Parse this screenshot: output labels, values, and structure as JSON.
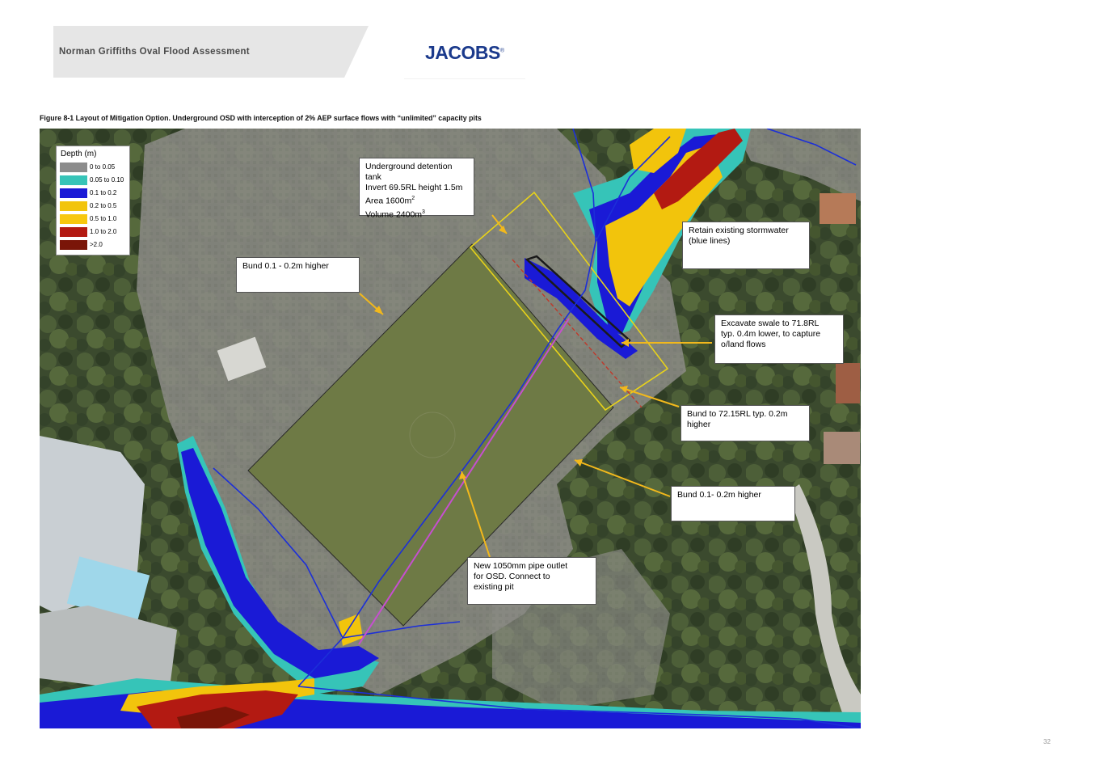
{
  "header": {
    "title": "Norman Griffiths Oval Flood Assessment",
    "logo": "JACOBS",
    "logo_mark": "®",
    "band_color": "#e6e6e6"
  },
  "figure": {
    "caption": "Figure 8-1 Layout of Mitigation Option. Underground OSD with interception of 2% AEP surface flows with “unlimited” capacity pits"
  },
  "legend": {
    "title": "Depth (m)",
    "items": [
      {
        "label": "0 to 0.05",
        "color": "#8c8c8c"
      },
      {
        "label": "0.05 to 0.10",
        "color": "#36c4b8"
      },
      {
        "label": "0.1 to 0.2",
        "color": "#1a1ad6"
      },
      {
        "label": "0.2 to 0.5",
        "color": "#f2c40c"
      },
      {
        "label": "0.5 to 1.0",
        "color": "#f7c80f"
      },
      {
        "label": "1.0 to 2.0",
        "color": "#b31a12"
      },
      {
        "label": ">2.0",
        "color": "#7a1508"
      }
    ]
  },
  "callouts": {
    "tank": {
      "line1": "Underground detention tank",
      "line2": "Invert 69.5RL height 1.5m",
      "line3_prefix": "Area 1600m",
      "line3_sup": "2",
      "line4_prefix": "Volume 2400m",
      "line4_sup": "3"
    },
    "bund_west": "Bund 0.1 - 0.2m higher",
    "retain": {
      "line1": "Retain existing stormwater",
      "line2": "(blue lines)"
    },
    "swale": {
      "line1": "Excavate swale to 71.8RL",
      "line2": "typ. 0.4m lower, to capture",
      "line3": "o/land flows"
    },
    "bund_72": {
      "line1": "Bund to 72.15RL typ. 0.2m",
      "line2": "higher"
    },
    "bund_east": "Bund 0.1- 0.2m higher",
    "pipe": {
      "line1": "New 1050mm pipe outlet",
      "line2": "for OSD. Connect to",
      "line3": "existing pit"
    }
  },
  "colors": {
    "leader": "#f2b81c",
    "stormwater": "#1c2fd8",
    "pipe": "#c64fd0",
    "tank_outline": "#e8d21a",
    "bund": "#c0392b",
    "swale": "#1a1a1a"
  },
  "page_number": "32"
}
